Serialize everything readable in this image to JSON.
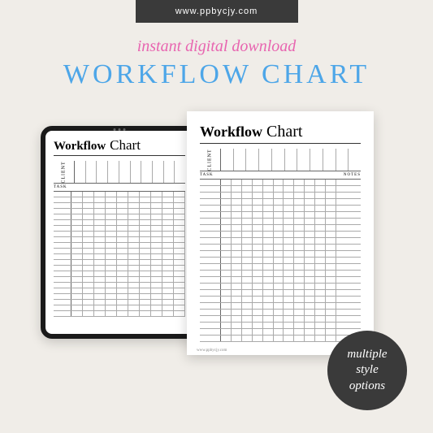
{
  "header": {
    "url": "www.ppbycjy.com",
    "tagline": "instant digital download",
    "title": "WORKFLOW CHART"
  },
  "sheet": {
    "title_word1": "Workflow",
    "title_word2": "Chart",
    "client_label": "CLIENT",
    "task_label": "TASK",
    "notes_label": "NOTES",
    "footer_url": "www.ppbycjy.com"
  },
  "badge": {
    "line1": "multiple",
    "line2": "style",
    "line3": "options"
  },
  "colors": {
    "url_bar_bg": "#3a3a3a",
    "tagline_color": "#e865b0",
    "title_color": "#4da6e8",
    "badge_bg": "#3a3a3a"
  }
}
